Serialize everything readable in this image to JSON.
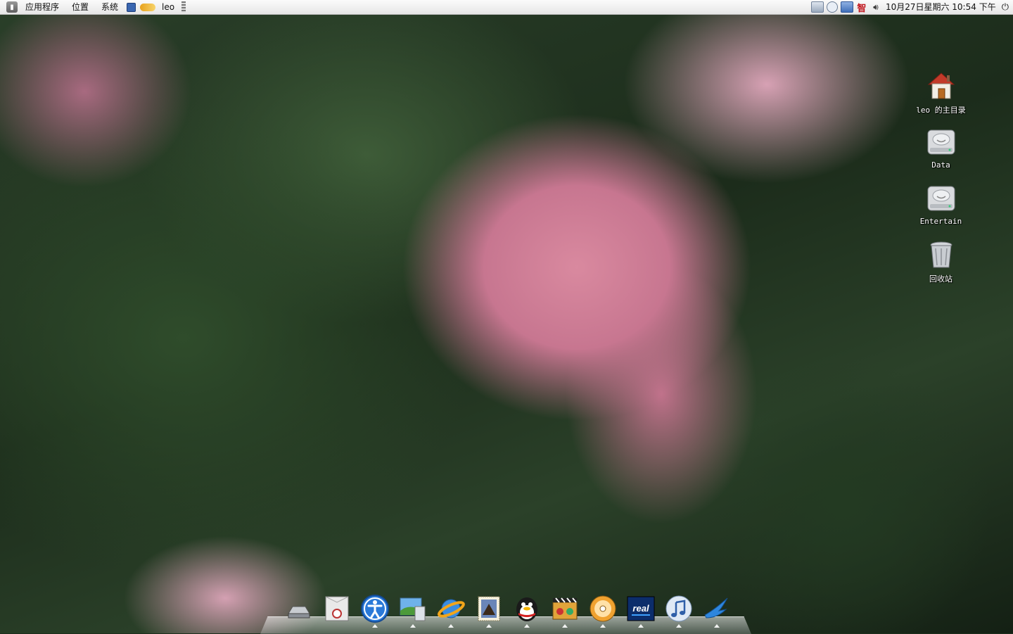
{
  "top_panel": {
    "menus": [
      "应用程序",
      "位置",
      "系统"
    ],
    "user": "leo",
    "clock": "10月27日星期六 10:54 下午",
    "ime_label": "智"
  },
  "desktop_icons": [
    {
      "label": "leo 的主目录",
      "icon": "home-folder-icon"
    },
    {
      "label": "Data",
      "icon": "hard-drive-icon"
    },
    {
      "label": "Entertain",
      "icon": "hard-drive-icon"
    },
    {
      "label": "回收站",
      "icon": "trash-icon"
    }
  ],
  "dock": {
    "items": [
      {
        "icon": "drive-icon",
        "running": false
      },
      {
        "icon": "file-manager-icon",
        "running": false
      },
      {
        "icon": "accessibility-icon",
        "running": true
      },
      {
        "icon": "image-viewer-icon",
        "running": true
      },
      {
        "icon": "web-browser-icon",
        "running": true
      },
      {
        "icon": "mail-stamp-icon",
        "running": true
      },
      {
        "icon": "qq-penguin-icon",
        "running": true
      },
      {
        "icon": "video-editor-icon",
        "running": true
      },
      {
        "icon": "disc-burner-icon",
        "running": true
      },
      {
        "icon": "realplayer-icon",
        "running": true
      },
      {
        "icon": "music-player-icon",
        "running": true
      },
      {
        "icon": "swallow-bird-icon",
        "running": true
      }
    ],
    "real_label": "real"
  },
  "colors": {
    "panel_bg": "#eeeeee",
    "ime_red": "#c0161d"
  }
}
